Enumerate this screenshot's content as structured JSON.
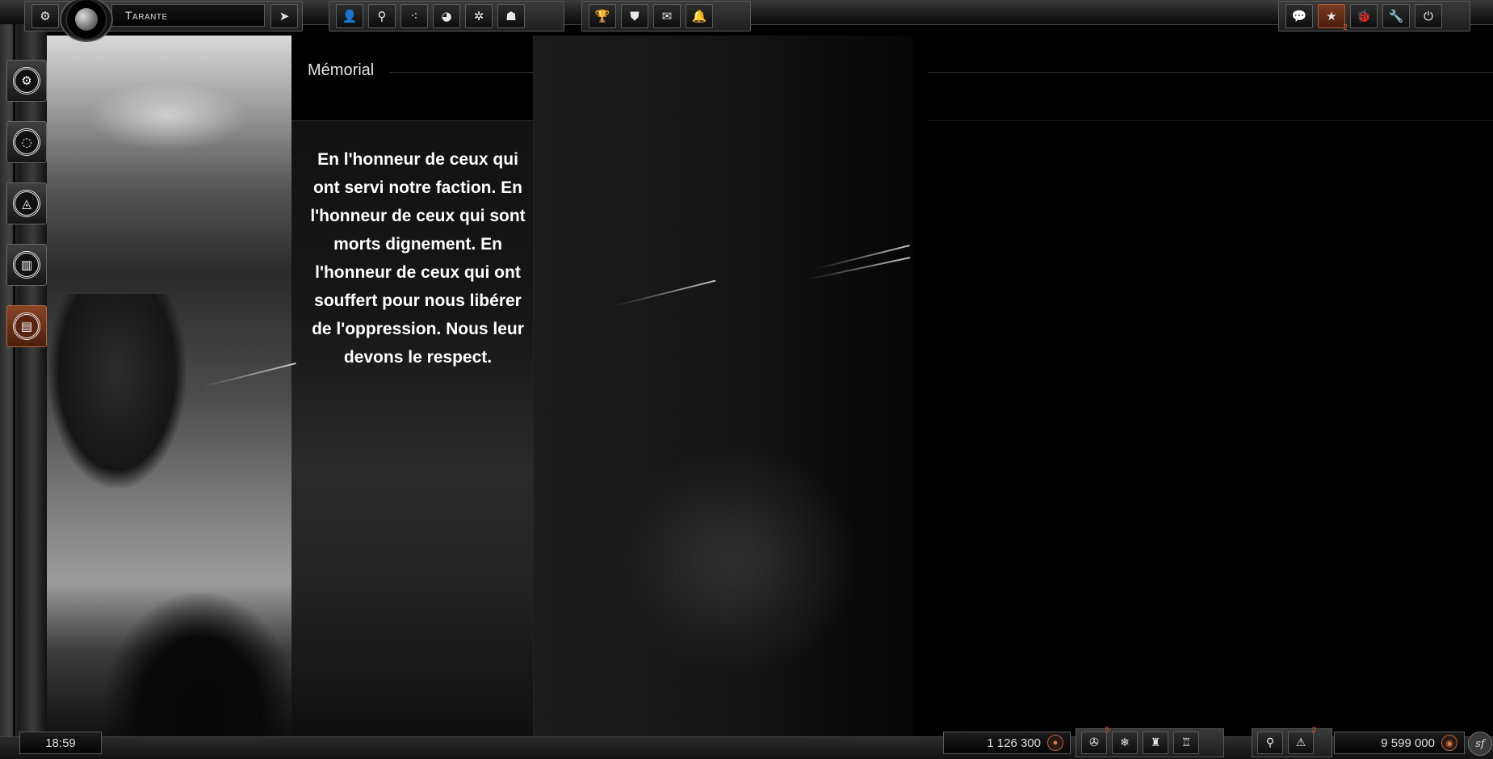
{
  "colors": {
    "accent": "#8a4527",
    "badge": "#e25a3a",
    "text": "#ffffff"
  },
  "header": {
    "planet_name": "Tarante",
    "settings_icon": "gear-icon",
    "go_icon": "arrow-right-icon"
  },
  "nav_center": {
    "icons": [
      "profile-icon",
      "fleet-icon",
      "galaxy-map-icon",
      "research-icon",
      "faction-icon",
      "ranking-icon"
    ]
  },
  "nav_social": {
    "icons": [
      "trophy-icon",
      "banner-icon",
      "mail-icon",
      "bell-icon"
    ]
  },
  "nav_right": {
    "icons": [
      "chat-icon",
      "star-icon",
      "bug-icon",
      "wrench-icon",
      "power-icon"
    ],
    "star_badge": "2"
  },
  "sidebar": {
    "items": [
      {
        "icon": "faction-emblem-icon",
        "glyph": "⚙",
        "active": false
      },
      {
        "icon": "ring-emblem-icon",
        "glyph": "◌",
        "active": false
      },
      {
        "icon": "eye-emblem-icon",
        "glyph": "◬",
        "active": false
      },
      {
        "icon": "barrier-emblem-icon",
        "glyph": "▥",
        "active": false
      },
      {
        "icon": "memorial-emblem-icon",
        "glyph": "▤",
        "active": true
      }
    ]
  },
  "main": {
    "title": "Mémorial",
    "text": "En l'honneur de ceux qui ont servi notre faction. En l'honneur de ceux qui sont morts dignement. En l'honneur de ceux qui ont souffert pour nous libérer de l'oppression. Nous leur devons le respect."
  },
  "footer": {
    "time": "18:59",
    "credits": "1 126 300",
    "credits_icon": "credits-icon",
    "fleet_badge": "5",
    "resource_group_icons": [
      "radiation-icon",
      "snowflake-icon",
      "tower-icon",
      "tower-alt-icon"
    ],
    "fleet_icons": [
      "fleet-icon",
      "fleet-alert-icon"
    ],
    "fleet_alert_badge": "2",
    "population": "9 599 000",
    "population_icon": "population-icon",
    "logo": "sf"
  }
}
